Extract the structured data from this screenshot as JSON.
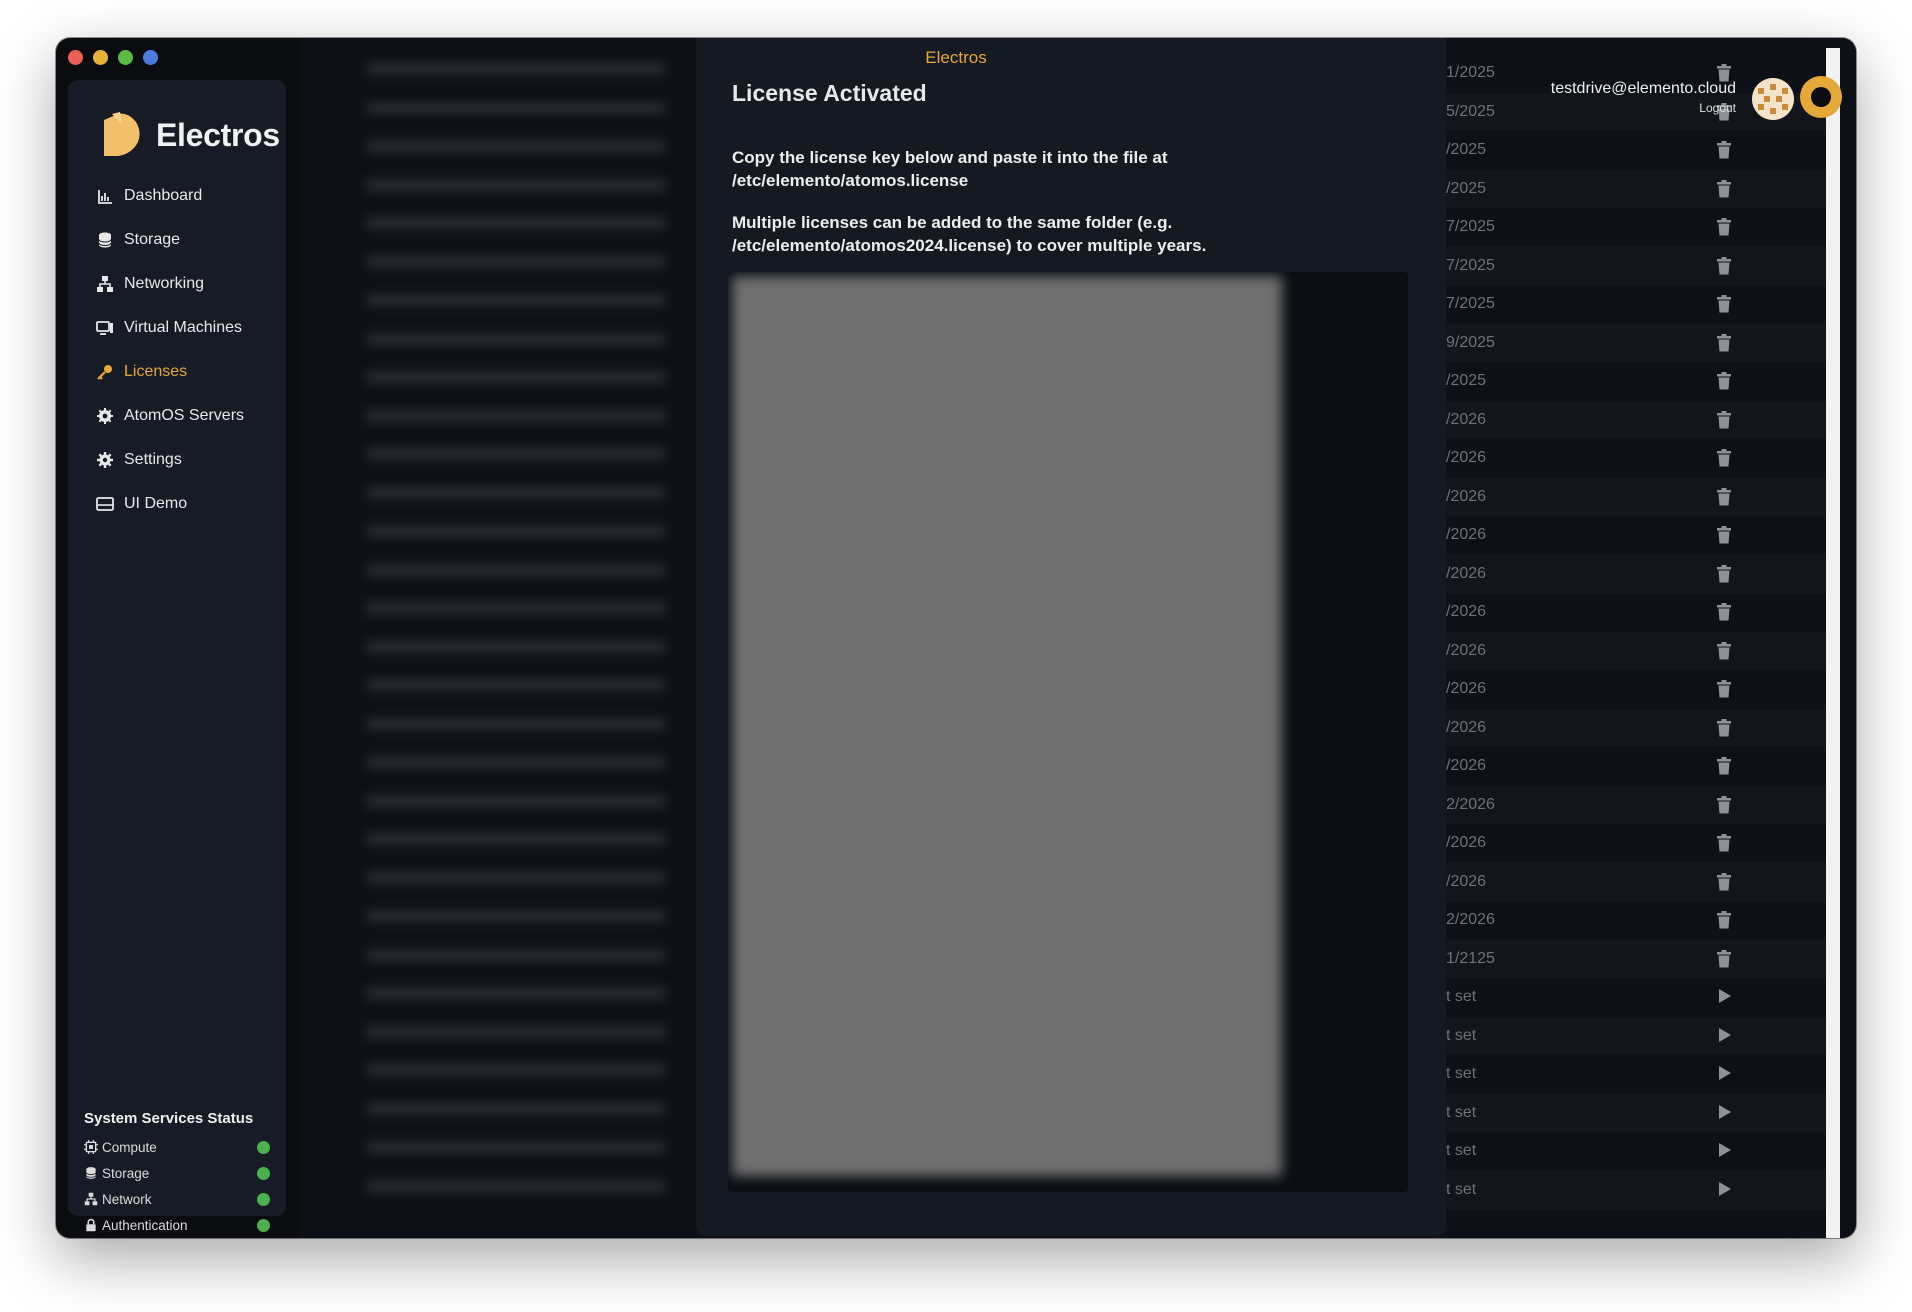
{
  "window": {
    "title": "Electros",
    "traffic_lights": [
      "#ec5f57",
      "#e6b23a",
      "#5cba47",
      "#4a7ce0"
    ]
  },
  "sidebar": {
    "brand": "Electros",
    "brand_color": "#f2c06a",
    "items": [
      {
        "label": "Dashboard",
        "icon": "chart-icon",
        "active": false
      },
      {
        "label": "Storage",
        "icon": "database-icon",
        "active": false
      },
      {
        "label": "Networking",
        "icon": "network-icon",
        "active": false
      },
      {
        "label": "Virtual Machines",
        "icon": "monitor-icon",
        "active": false
      },
      {
        "label": "Licenses",
        "icon": "key-icon",
        "active": true
      },
      {
        "label": "AtomOS Servers",
        "icon": "cog-icon",
        "active": false
      },
      {
        "label": "Settings",
        "icon": "gear-icon",
        "active": false
      },
      {
        "label": "UI Demo",
        "icon": "window-icon",
        "active": false
      }
    ],
    "status": {
      "title": "System Services Status",
      "services": [
        {
          "label": "Compute",
          "icon": "cpu-icon",
          "status": "ok"
        },
        {
          "label": "Storage",
          "icon": "database-icon",
          "status": "ok"
        },
        {
          "label": "Network",
          "icon": "network-icon",
          "status": "ok"
        },
        {
          "label": "Authentication",
          "icon": "lock-icon",
          "status": "ok"
        }
      ]
    }
  },
  "header": {
    "user_email": "testdrive@elemento.cloud",
    "logout_label": "Logout"
  },
  "modal": {
    "title": "License Activated",
    "paragraph1_line1": "Copy the license key below and paste it into the file at",
    "paragraph1_line2": "/etc/elemento/atomos.license",
    "paragraph2_line1": "Multiple licenses can be added to the same folder (e.g.",
    "paragraph2_line2": "/etc/elemento/atomos2024.license) to cover multiple years."
  },
  "table": {
    "rows": [
      {
        "date": "1/2025",
        "action": "trash-icon"
      },
      {
        "date": "5/2025",
        "action": "trash-icon"
      },
      {
        "date": "/2025",
        "action": "trash-icon"
      },
      {
        "date": "/2025",
        "action": "trash-icon"
      },
      {
        "date": "7/2025",
        "action": "trash-icon"
      },
      {
        "date": "7/2025",
        "action": "trash-icon"
      },
      {
        "date": "7/2025",
        "action": "trash-icon"
      },
      {
        "date": "9/2025",
        "action": "trash-icon"
      },
      {
        "date": "/2025",
        "action": "trash-icon"
      },
      {
        "date": "/2026",
        "action": "trash-icon"
      },
      {
        "date": "/2026",
        "action": "trash-icon"
      },
      {
        "date": "/2026",
        "action": "trash-icon"
      },
      {
        "date": "/2026",
        "action": "trash-icon"
      },
      {
        "date": "/2026",
        "action": "trash-icon"
      },
      {
        "date": "/2026",
        "action": "trash-icon"
      },
      {
        "date": "/2026",
        "action": "trash-icon"
      },
      {
        "date": "/2026",
        "action": "trash-icon"
      },
      {
        "date": "/2026",
        "action": "trash-icon"
      },
      {
        "date": "/2026",
        "action": "trash-icon"
      },
      {
        "date": "2/2026",
        "action": "trash-icon"
      },
      {
        "date": "/2026",
        "action": "trash-icon"
      },
      {
        "date": "/2026",
        "action": "trash-icon"
      },
      {
        "date": "2/2026",
        "action": "trash-icon"
      },
      {
        "date": "1/2125",
        "action": "trash-icon"
      },
      {
        "date": "t set",
        "action": "play-icon"
      },
      {
        "date": "t set",
        "action": "play-icon"
      },
      {
        "date": "t set",
        "action": "play-icon"
      },
      {
        "date": "t set",
        "action": "play-icon"
      },
      {
        "date": "t set",
        "action": "play-icon"
      },
      {
        "date": "t set",
        "action": "play-icon"
      }
    ]
  },
  "colors": {
    "accent": "#e7a83a",
    "status_ok": "#4caf50",
    "sidebar_bg": "#171b25",
    "modal_bg": "#151922"
  }
}
